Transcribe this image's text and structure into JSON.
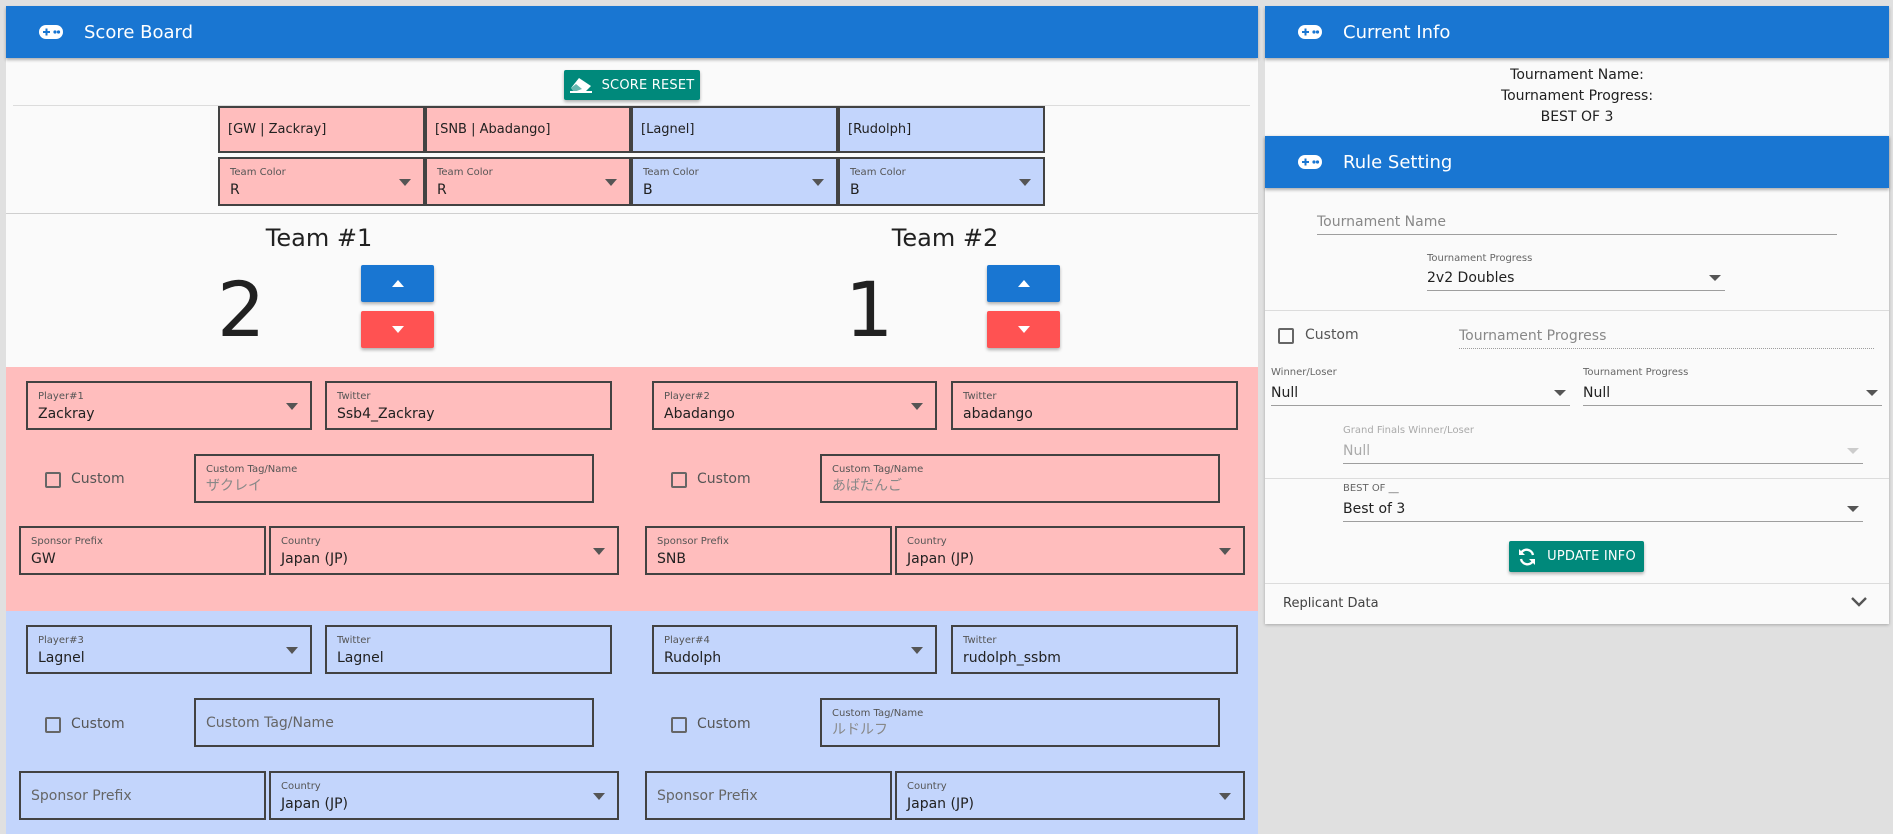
{
  "colors": {
    "primary": "#1976d2",
    "teal": "#00897b",
    "red_team": "#ffbdbd",
    "blue_team": "#c3d5fc",
    "up": "#1976d2",
    "down": "#ff5252"
  },
  "scoreboard": {
    "title": "Score Board",
    "reset_label": "SCORE RESET",
    "tags": [
      "[GW | Zackray]",
      "[SNB | Abadango]",
      "[Lagnel]",
      "[Rudolph]"
    ],
    "team_color_label": "Team Color",
    "team_colors": [
      "R",
      "R",
      "B",
      "B"
    ]
  },
  "teams": [
    {
      "title": "Team #1",
      "score": "2"
    },
    {
      "title": "Team #2",
      "score": "1"
    }
  ],
  "players": [
    {
      "player_label": "Player#1",
      "name": "Zackray",
      "twitter_label": "Twitter",
      "twitter": "Ssb4_Zackray",
      "custom_label": "Custom",
      "custom_tag_label": "Custom Tag/Name",
      "custom_tag": "ザクレイ",
      "sponsor_label": "Sponsor Prefix",
      "sponsor": "GW",
      "country_label": "Country",
      "country": "Japan (JP)"
    },
    {
      "player_label": "Player#2",
      "name": "Abadango",
      "twitter_label": "Twitter",
      "twitter": "abadango",
      "custom_label": "Custom",
      "custom_tag_label": "Custom Tag/Name",
      "custom_tag": "あばだんご",
      "sponsor_label": "Sponsor Prefix",
      "sponsor": "SNB",
      "country_label": "Country",
      "country": "Japan (JP)"
    },
    {
      "player_label": "Player#3",
      "name": "Lagnel",
      "twitter_label": "Twitter",
      "twitter": "Lagnel",
      "custom_label": "Custom",
      "custom_tag_placeholder": "Custom Tag/Name",
      "sponsor_placeholder": "Sponsor Prefix",
      "country_label": "Country",
      "country": "Japan (JP)"
    },
    {
      "player_label": "Player#4",
      "name": "Rudolph",
      "twitter_label": "Twitter",
      "twitter": "rudolph_ssbm",
      "custom_label": "Custom",
      "custom_tag_label": "Custom Tag/Name",
      "custom_tag": "ルドルフ",
      "sponsor_placeholder": "Sponsor Prefix",
      "country_label": "Country",
      "country": "Japan (JP)"
    }
  ],
  "current_info": {
    "title": "Current Info",
    "tournament_name_line": "Tournament Name:",
    "tournament_progress_line": "Tournament Progress:",
    "best_of_line": "BEST OF 3"
  },
  "rule_setting": {
    "title": "Rule Setting",
    "tournament_name_placeholder": "Tournament Name",
    "progress_label": "Tournament Progress",
    "progress_value": "2v2 Doubles",
    "custom_label": "Custom",
    "custom_progress_placeholder": "Tournament Progress",
    "winner_loser_label": "Winner/Loser",
    "winner_loser_value": "Null",
    "progress2_label": "Tournament Progress",
    "progress2_value": "Null",
    "grand_finals_label": "Grand Finals Winner/Loser",
    "grand_finals_value": "Null",
    "best_of_label": "BEST OF __",
    "best_of_value": "Best of 3",
    "update_label": "UPDATE INFO",
    "replicant_label": "Replicant Data"
  }
}
